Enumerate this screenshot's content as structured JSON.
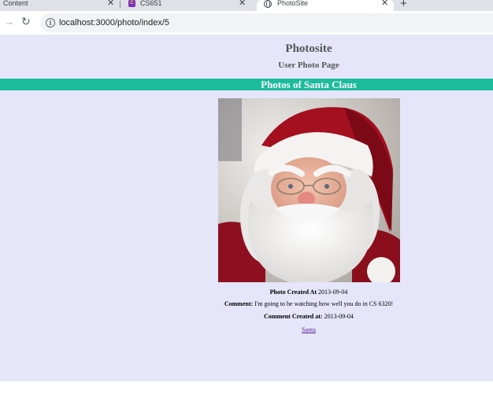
{
  "browser": {
    "tabs": [
      {
        "label": "Content"
      },
      {
        "label": "CS651"
      },
      {
        "label": "PhotoSite",
        "active": true
      }
    ],
    "url": "localhost:3000/photo/index/5",
    "icons": [
      "close-icon",
      "new-tab-icon",
      "forward-icon",
      "reload-icon",
      "info-icon",
      "globe-icon"
    ]
  },
  "page": {
    "site_title": "Photosite",
    "subtitle": "User Photo Page",
    "banner": "Photos of Santa Claus",
    "banner_color": "#1abc9c",
    "background_color": "#e6e6fa",
    "photo": {
      "subject": "Santa Claus portrait",
      "created_label": "Photo Created At",
      "created_value": "2013-09-04"
    },
    "comment": {
      "label": "Comment:",
      "text": "I'm going to be watching how well you do in CS 6320!",
      "created_label": "Comment Created at:",
      "created_value": "2013-09-04",
      "author_link": "Santa"
    }
  }
}
